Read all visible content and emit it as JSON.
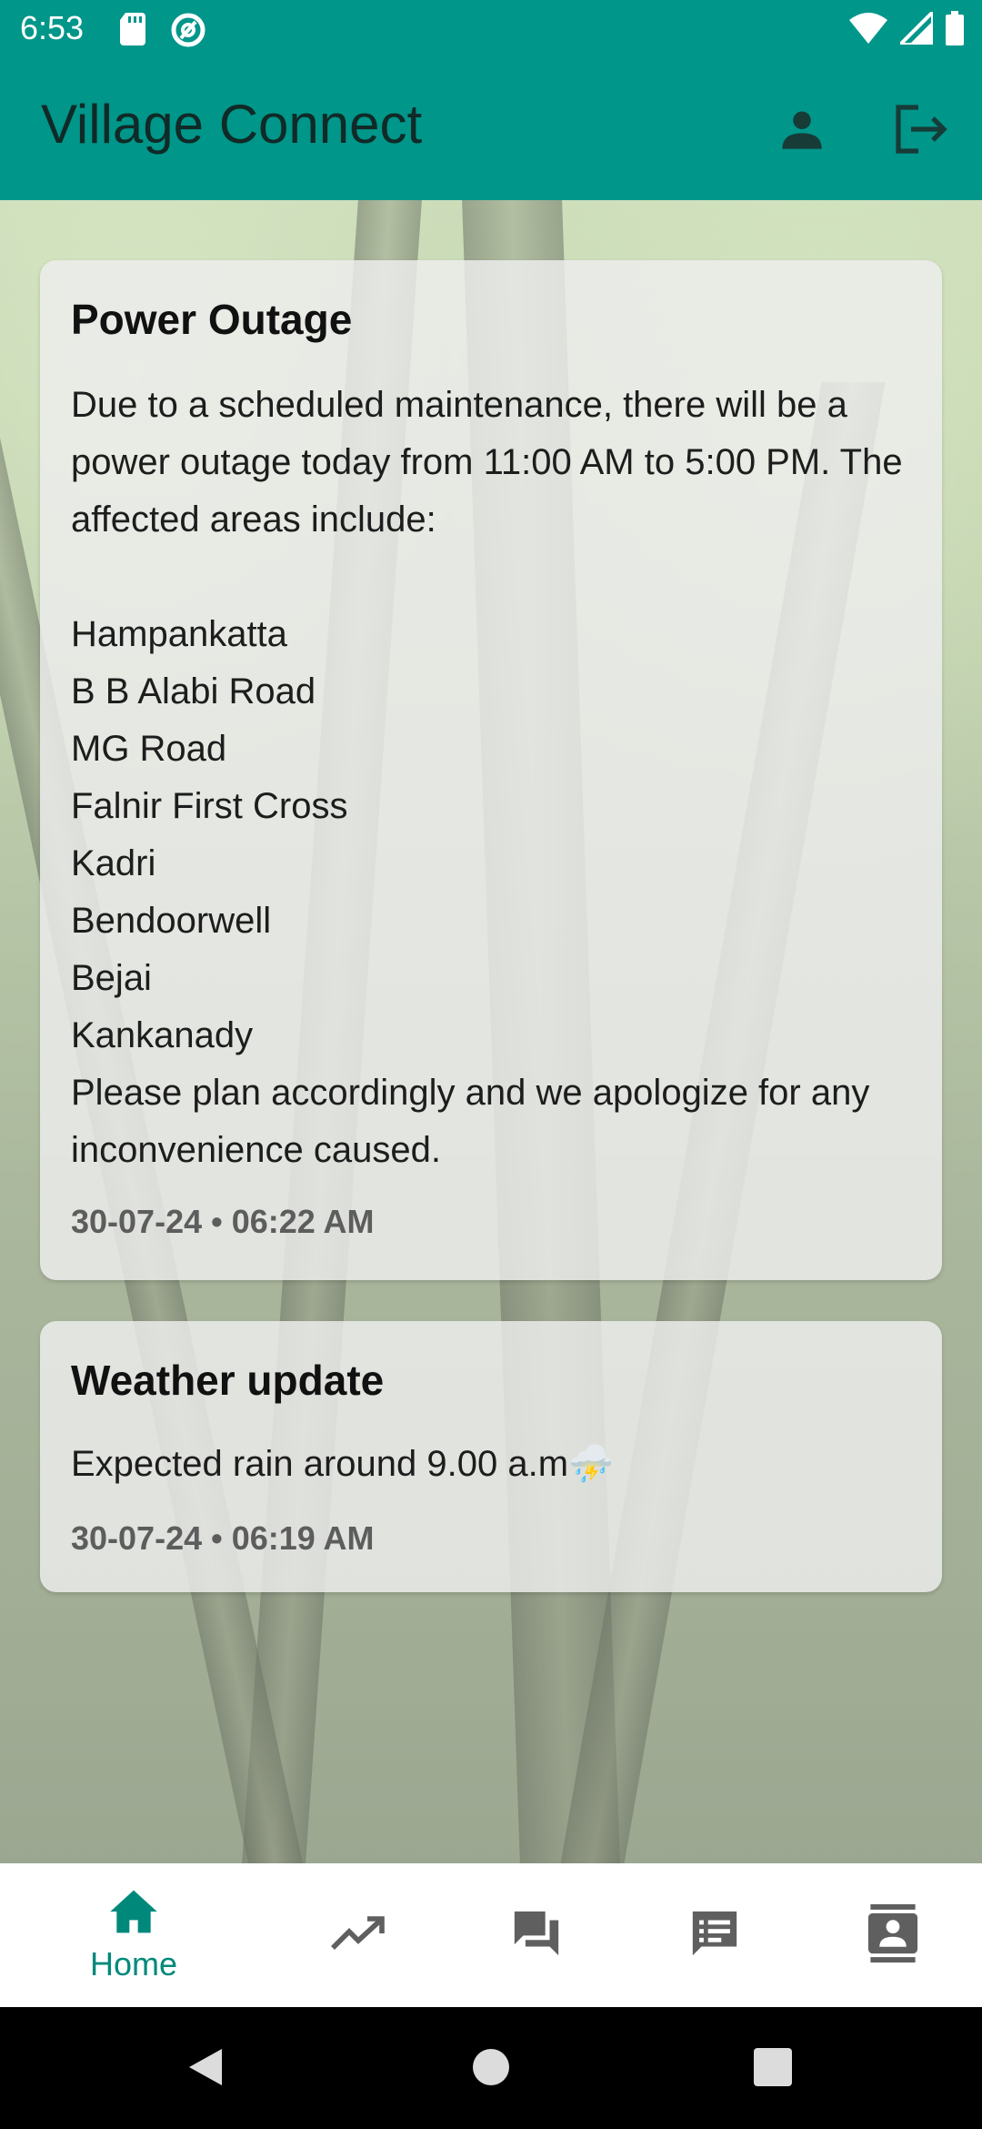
{
  "status_bar": {
    "time": "6:53",
    "left_icons": [
      "sd-card-icon",
      "at-sign-icon"
    ],
    "right_icons": [
      "wifi-icon",
      "signal-icon",
      "battery-icon"
    ]
  },
  "app_bar": {
    "title": "Village Connect",
    "actions": [
      "person-icon",
      "logout-icon"
    ],
    "color": "#00968a"
  },
  "posts": [
    {
      "title": "Power Outage",
      "body": "Due to a scheduled maintenance, there will be a power outage today from 11:00 AM to 5:00 PM. The affected areas include:\n\nHampankatta\nB B Alabi Road\nMG Road\nFalnir First Cross\nKadri\nBendoorwell\nBejai\nKankanady\nPlease plan accordingly and we apologize for any inconvenience caused.",
      "timestamp": "30-07-24 • 06:22 AM"
    },
    {
      "title": "Weather update",
      "body": "Expected  rain around 9.00 a.m",
      "emoji": "⛈️",
      "timestamp": "30-07-24 • 06:19 AM"
    }
  ],
  "bottom_nav": {
    "items": [
      {
        "label": "Home",
        "icon": "home-icon",
        "active": true
      },
      {
        "label": "",
        "icon": "trending-up-icon",
        "active": false
      },
      {
        "label": "",
        "icon": "forum-icon",
        "active": false
      },
      {
        "label": "",
        "icon": "feed-icon",
        "active": false
      },
      {
        "label": "",
        "icon": "contact-card-icon",
        "active": false
      }
    ],
    "active_color": "#00897b",
    "inactive_color": "#5f5f5f"
  },
  "system_nav": [
    "back-icon",
    "home-circle-icon",
    "recents-icon"
  ]
}
